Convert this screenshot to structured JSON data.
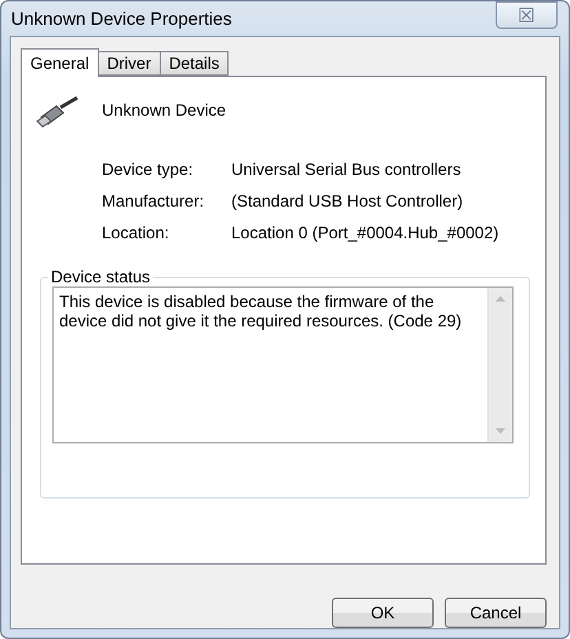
{
  "window": {
    "title": "Unknown Device Properties",
    "close": "☒"
  },
  "tabs": [
    {
      "label": "General",
      "selected": true
    },
    {
      "label": "Driver",
      "selected": false
    },
    {
      "label": "Details",
      "selected": false
    }
  ],
  "device": {
    "name": "Unknown Device"
  },
  "properties": [
    {
      "label": "Device type:",
      "value": "Universal Serial Bus controllers"
    },
    {
      "label": "Manufacturer:",
      "value": "(Standard USB Host Controller)"
    },
    {
      "label": "Location:",
      "value": "Location 0 (Port_#0004.Hub_#0002)"
    }
  ],
  "status": {
    "title": "Device status",
    "text": "This device is disabled because the firmware of the device did not give it the required resources. (Code 29)"
  },
  "buttons": [
    "OK",
    "Cancel"
  ]
}
